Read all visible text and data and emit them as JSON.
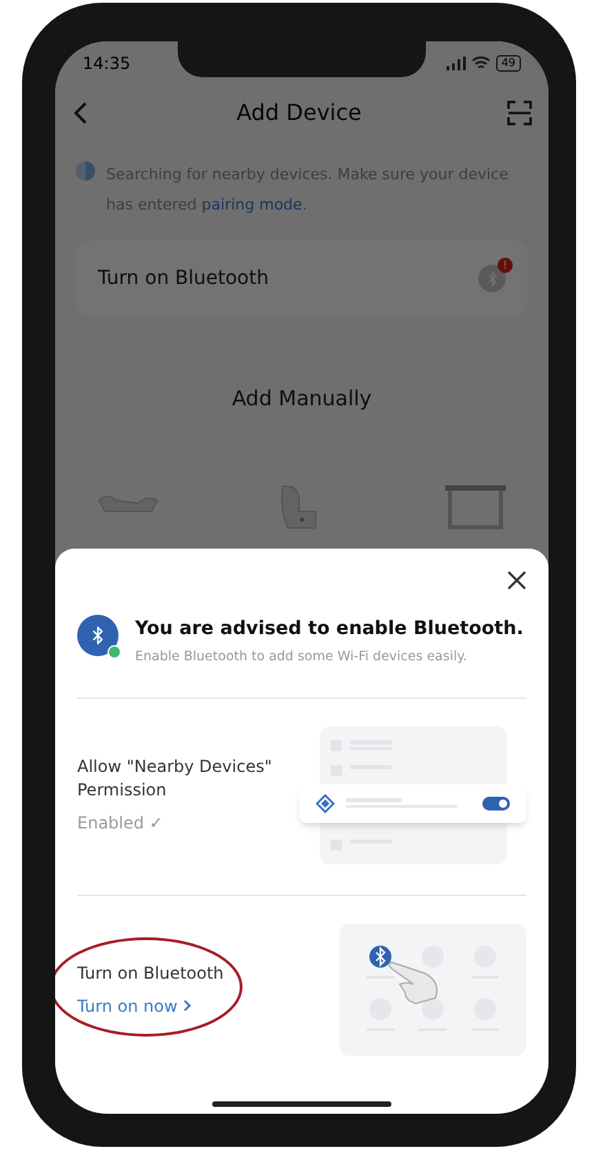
{
  "status_bar": {
    "time": "14:35",
    "battery": "49"
  },
  "header": {
    "title": "Add Device"
  },
  "notice": {
    "text": "Searching for nearby devices. Make sure your device has entered",
    "link": "pairing mode",
    "end": "."
  },
  "bluetooth_card": {
    "label": "Turn on Bluetooth",
    "badge": "!"
  },
  "manual": {
    "title": "Add Manually"
  },
  "sheet": {
    "title": "You are advised to enable Bluetooth.",
    "subtitle": "Enable Bluetooth to add some Wi-Fi devices easily.",
    "steps": [
      {
        "kind": "permission",
        "title": "Allow \"Nearby Devices\" Permission",
        "status": "Enabled ✓",
        "highlighted": false
      },
      {
        "kind": "bluetooth",
        "title": "Turn on Bluetooth",
        "action": "Turn on now",
        "highlighted": true
      }
    ]
  }
}
